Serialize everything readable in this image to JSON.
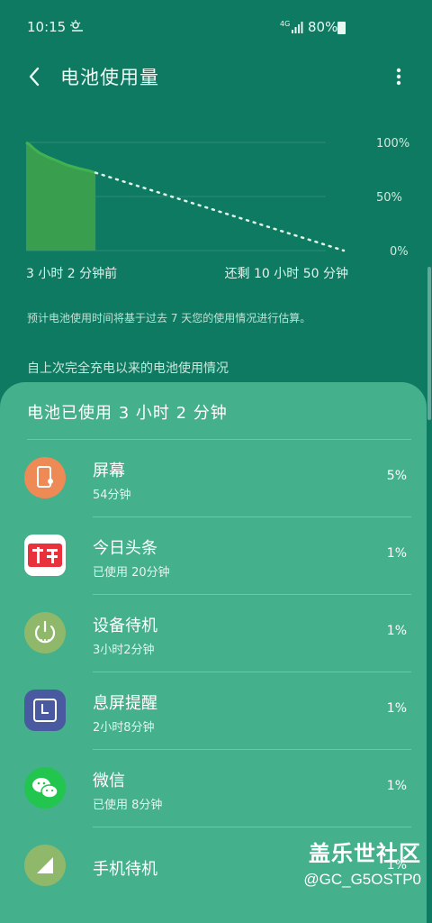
{
  "status_bar": {
    "time": "10:15",
    "network": "4G",
    "battery": "80%"
  },
  "header": {
    "title": "电池使用量"
  },
  "chart_data": {
    "type": "line",
    "y_ticks": [
      "100%",
      "50%",
      "0%"
    ],
    "ylim": [
      0,
      100
    ],
    "x_label_left": "3 小时 2 分钟前",
    "x_label_right": "还剩 10 小时 50 分钟",
    "series": [
      {
        "points": [
          [
            0,
            100
          ],
          [
            0.15,
            98
          ],
          [
            0.35,
            94
          ],
          [
            0.6,
            90
          ],
          [
            1.0,
            86
          ],
          [
            1.35,
            83
          ],
          [
            1.8,
            79
          ],
          [
            2.3,
            76
          ],
          [
            2.7,
            74
          ],
          [
            3.03,
            72
          ]
        ]
      },
      {
        "points": [
          [
            3.03,
            72
          ],
          [
            13.87,
            0
          ]
        ]
      }
    ],
    "colors": {
      "line": "#3fb352",
      "area": "#3a9e4f",
      "projection": "#dff5e8"
    }
  },
  "info": {
    "note": "预计电池使用时间将基于过去 7 天您的使用情况进行估算。",
    "section_label": "自上次完全充电以来的电池使用情况"
  },
  "sheet": {
    "title": "电池已使用 3 小时 2 分钟",
    "items": [
      {
        "name": "屏幕",
        "sub": "54分钟",
        "pct": "5%",
        "icon": "screen-brightness-icon",
        "color": "#ee8a55"
      },
      {
        "name": "今日头条",
        "sub": "已使用 20分钟",
        "pct": "1%",
        "icon": "toutiao-app-icon",
        "color": "#e9313c"
      },
      {
        "name": "设备待机",
        "sub": "3小时2分钟",
        "pct": "1%",
        "icon": "power-standby-icon",
        "color": "#8fb86a"
      },
      {
        "name": "息屏提醒",
        "sub": "2小时8分钟",
        "pct": "1%",
        "icon": "always-on-display-icon",
        "color": "#4a5aa0"
      },
      {
        "name": "微信",
        "sub": "已使用 8分钟",
        "pct": "1%",
        "icon": "wechat-app-icon",
        "color": "#22c54e"
      },
      {
        "name": "手机待机",
        "sub": "",
        "pct": "1%",
        "icon": "cell-signal-icon",
        "color": "#8fb86a"
      }
    ]
  },
  "watermark": {
    "line1": "盖乐世社区",
    "line2": "@GC_G5OSTP0"
  }
}
